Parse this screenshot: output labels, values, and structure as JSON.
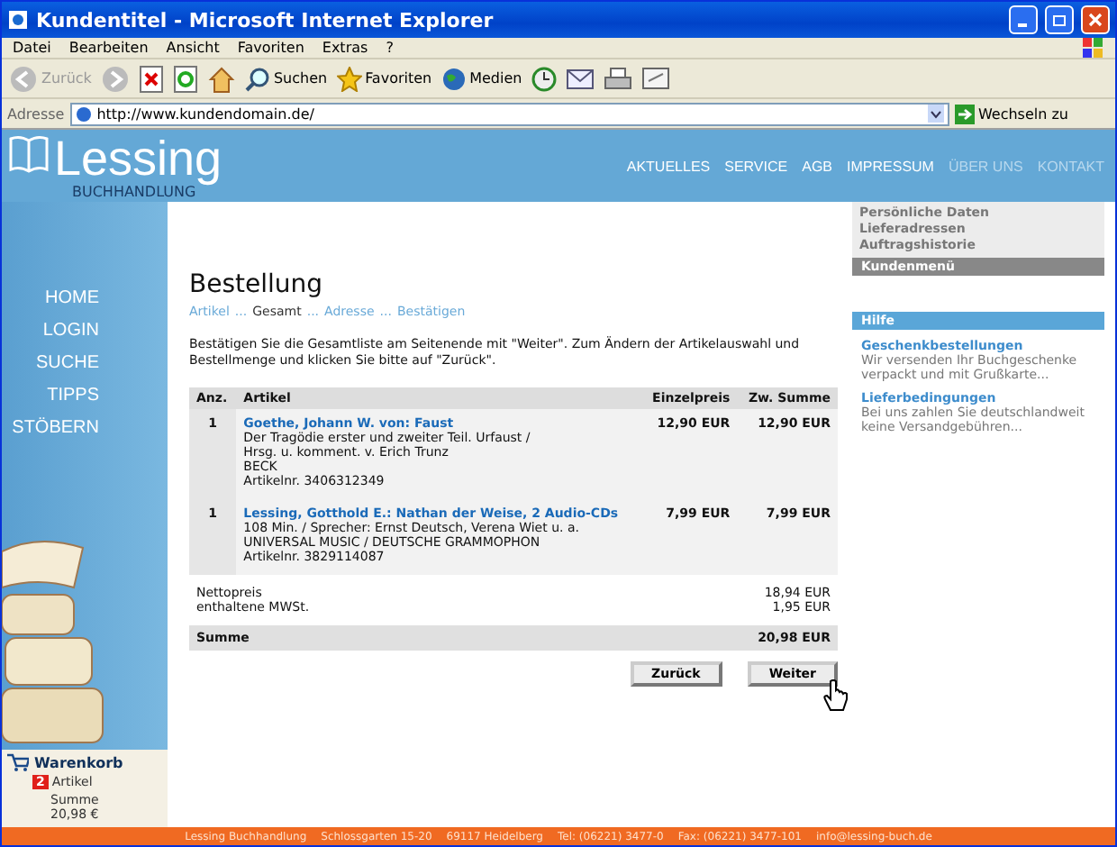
{
  "window": {
    "title": "Kundentitel - Microsoft Internet Explorer"
  },
  "menu": [
    "Datei",
    "Bearbeiten",
    "Ansicht",
    "Favoriten",
    "Extras",
    "?"
  ],
  "toolbar": [
    {
      "kind": "back",
      "label": "Zurück",
      "disabled": true
    },
    {
      "kind": "forward",
      "disabled": true
    },
    {
      "kind": "stop"
    },
    {
      "kind": "refresh"
    },
    {
      "kind": "home"
    },
    {
      "kind": "search",
      "label": "Suchen"
    },
    {
      "kind": "favorites",
      "label": "Favoriten"
    },
    {
      "kind": "media",
      "label": "Medien"
    },
    {
      "kind": "history"
    },
    {
      "kind": "mail"
    },
    {
      "kind": "print"
    },
    {
      "kind": "edit"
    }
  ],
  "address": {
    "label": "Adresse",
    "value": "http://www.kundendomain.de/",
    "go": "Wechseln zu"
  },
  "site": {
    "logo": "Lessing",
    "logo_sub": "BUCHHANDLUNG",
    "top_nav": [
      {
        "label": "AKTUELLES",
        "dimmed": false
      },
      {
        "label": "SERVICE",
        "dimmed": false
      },
      {
        "label": "AGB",
        "dimmed": false
      },
      {
        "label": "IMPRESSUM",
        "dimmed": false
      },
      {
        "label": "ÜBER UNS",
        "dimmed": true
      },
      {
        "label": "KONTAKT",
        "dimmed": true
      }
    ],
    "side_nav": [
      "HOME",
      "LOGIN",
      "SUCHE",
      "TIPPS",
      "STÖBERN"
    ],
    "cart": {
      "title": "Warenkorb",
      "count": "2",
      "count_label": "Artikel",
      "sum_label": "Summe",
      "sum": "20,98 €"
    },
    "customer_menu": {
      "items": [
        "Persönliche Daten",
        "Lieferadressen",
        "Auftragshistorie"
      ],
      "title": "Kundenmenü"
    },
    "help": {
      "title": "Hilfe",
      "items": [
        {
          "title": "Geschenkbestellungen",
          "text": "Wir versenden Ihr Buchgeschenke verpackt und mit Grußkarte..."
        },
        {
          "title": "Lieferbedingungen",
          "text": "Bei uns zahlen Sie deutschlandweit keine Versandgebühren..."
        }
      ]
    },
    "footer": [
      "Lessing Buchhandlung",
      "Schlossgarten 15-20",
      "69117 Heidelberg",
      "Tel: (06221) 3477-0",
      "Fax: (06221) 3477-101",
      "info@lessing-buch.de"
    ]
  },
  "order": {
    "title": "Bestellung",
    "step_separator": "...",
    "steps": [
      {
        "label": "Artikel",
        "selected": false
      },
      {
        "label": "Gesamt",
        "selected": true
      },
      {
        "label": "Adresse",
        "selected": false
      },
      {
        "label": "Bestätigen",
        "selected": false
      }
    ],
    "intro": "Bestätigen Sie die Gesamtliste am Seitenende mit \"Weiter\". Zum Ändern der Artikelauswahl und Bestellmenge und klicken Sie bitte auf  \"Zurück\".",
    "table": {
      "columns": [
        "Anz.",
        "Artikel",
        "Einzelpreis",
        "Zw. Summe"
      ],
      "rows": [
        {
          "qty": "1",
          "title": "Goethe, Johann W. von: Faust",
          "details": [
            "Der Tragödie erster und zweiter Teil. Urfaust /",
            "Hrsg. u. komment. v. Erich Trunz",
            "BECK",
            "Artikelnr. 3406312349"
          ],
          "price": "12,90 EUR",
          "subtotal": "12,90 EUR"
        },
        {
          "qty": "1",
          "title": "Lessing, Gotthold E.: Nathan der Weise, 2 Audio-CDs",
          "details": [
            "108 Min. / Sprecher: Ernst Deutsch, Verena Wiet u. a.",
            "UNIVERSAL MUSIC / DEUTSCHE GRAMMOPHON",
            "Artikelnr. 3829114087"
          ],
          "price": "7,99 EUR",
          "subtotal": "7,99 EUR"
        }
      ]
    },
    "totals": [
      {
        "label": "Nettopreis",
        "value": "18,94 EUR"
      },
      {
        "label": "enthaltene MWSt.",
        "value": "1,95 EUR"
      }
    ],
    "sum": {
      "label": "Summe",
      "value": "20,98 EUR"
    },
    "buttons": [
      "Zurück",
      "Weiter"
    ]
  }
}
